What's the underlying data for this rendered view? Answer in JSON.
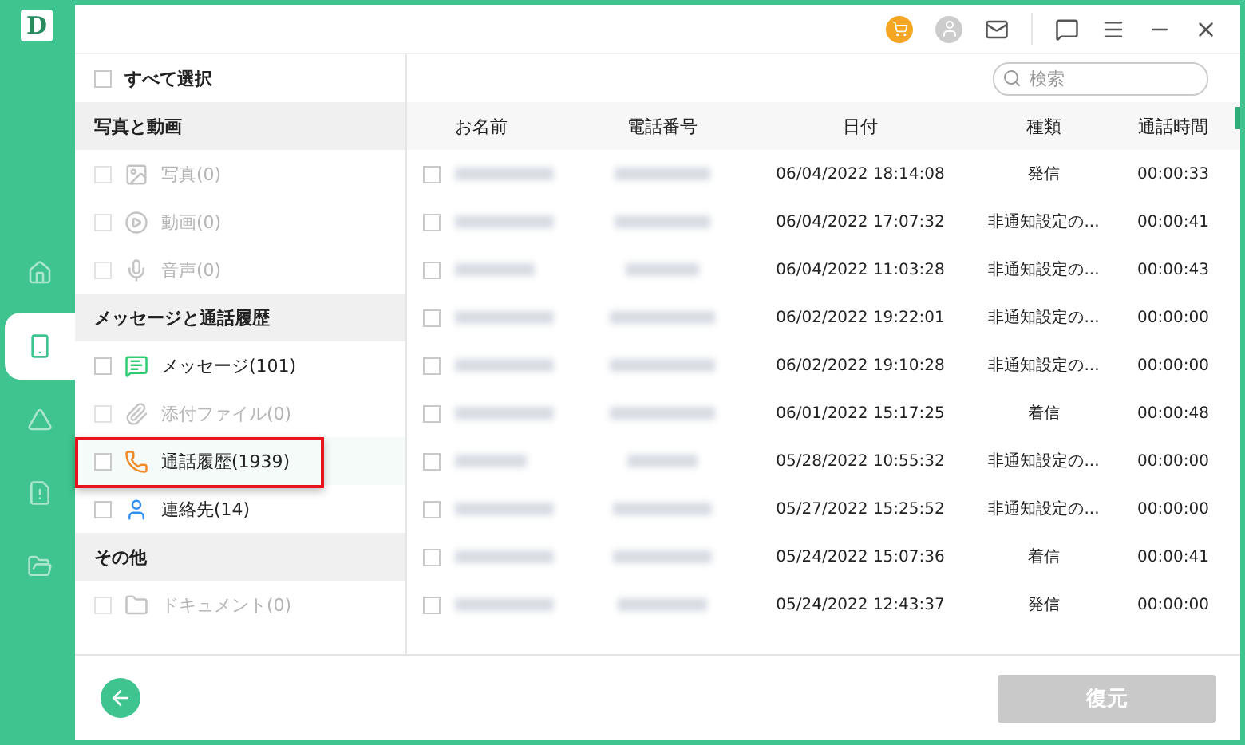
{
  "nav": [
    {
      "selected": false
    },
    {
      "selected": true
    },
    {
      "selected": false
    },
    {
      "selected": false
    },
    {
      "selected": false
    }
  ],
  "select_all": {
    "label": "すべて選択",
    "checked": false
  },
  "categories": [
    {
      "title": "写真と動画",
      "items": [
        {
          "label": "写真(0)",
          "disabled": true,
          "checked": false,
          "selected": false
        },
        {
          "label": "動画(0)",
          "disabled": true,
          "checked": false,
          "selected": false
        },
        {
          "label": "音声(0)",
          "disabled": true,
          "checked": false,
          "selected": false
        }
      ]
    },
    {
      "title": "メッセージと通話履歴",
      "items": [
        {
          "label": "メッセージ(101)",
          "disabled": false,
          "checked": false,
          "selected": false
        },
        {
          "label": "添付ファイル(0)",
          "disabled": true,
          "checked": false,
          "selected": false
        },
        {
          "label": "通話履歴(1939)",
          "disabled": false,
          "checked": false,
          "selected": true
        },
        {
          "label": "連絡先(14)",
          "disabled": false,
          "checked": false,
          "selected": false
        }
      ]
    },
    {
      "title": "その他",
      "items": [
        {
          "label": "ドキュメント(0)",
          "disabled": true,
          "checked": false,
          "selected": false
        }
      ]
    }
  ],
  "search": {
    "placeholder": "検索"
  },
  "table": {
    "columns": [
      "お名前",
      "電話番号",
      "日付",
      "種類",
      "通話時間"
    ],
    "rows": [
      {
        "checked": false,
        "date": "06/04/2022 18:14:08",
        "type": "発信",
        "duration": "00:00:33"
      },
      {
        "checked": false,
        "date": "06/04/2022 17:07:32",
        "type": "非通知設定の...",
        "duration": "00:00:41"
      },
      {
        "checked": false,
        "date": "06/04/2022 11:03:28",
        "type": "非通知設定の...",
        "duration": "00:00:43"
      },
      {
        "checked": false,
        "date": "06/02/2022 19:22:01",
        "type": "非通知設定の...",
        "duration": "00:00:00"
      },
      {
        "checked": false,
        "date": "06/02/2022 19:10:28",
        "type": "非通知設定の...",
        "duration": "00:00:00"
      },
      {
        "checked": false,
        "date": "06/01/2022 15:17:25",
        "type": "着信",
        "duration": "00:00:48"
      },
      {
        "checked": false,
        "date": "05/28/2022 10:55:32",
        "type": "非通知設定の...",
        "duration": "00:00:00"
      },
      {
        "checked": false,
        "date": "05/27/2022 15:25:52",
        "type": "非通知設定の...",
        "duration": "00:00:00"
      },
      {
        "checked": false,
        "date": "05/24/2022 15:07:36",
        "type": "着信",
        "duration": "00:00:41"
      },
      {
        "checked": false,
        "date": "05/24/2022 12:43:37",
        "type": "発信",
        "duration": "00:00:00"
      }
    ]
  },
  "logo": "D",
  "restore_button": {
    "label": "復元",
    "disabled": true
  }
}
